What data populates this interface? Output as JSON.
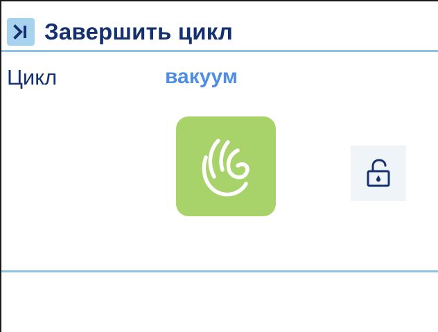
{
  "header": {
    "title": "Завершить цикл",
    "icon": "end-cycle-icon"
  },
  "cycle": {
    "label": "Цикл",
    "value": "вакуум"
  },
  "tiles": {
    "vacuum": {
      "icon": "vacuum-hand-icon",
      "color": "#a8d26a"
    },
    "lock": {
      "icon": "unlock-icon"
    }
  },
  "colors": {
    "title": "#14306e",
    "cycle_value": "#4f8ee2",
    "divider": "#8dc3e6",
    "header_icon_bg": "#a8d3ee"
  }
}
